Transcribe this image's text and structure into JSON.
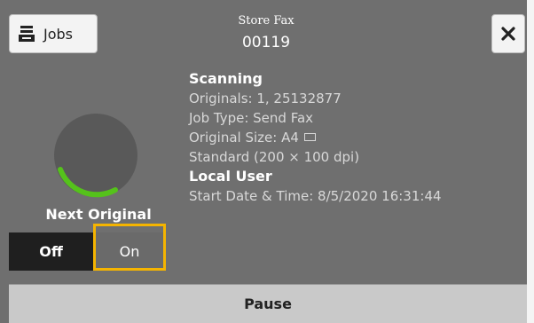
{
  "header": {
    "title": "Store Fax",
    "code": "00119",
    "jobs_label": "Jobs",
    "jobs_icon": "job-list-icon",
    "close_icon": "close-icon"
  },
  "progress": {
    "icon": "progress-spinner-icon",
    "accent_color": "#55c21b"
  },
  "details": {
    "heading_scanning": "Scanning",
    "originals": "Originals: 1, 25132877",
    "job_type": "Job Type: Send Fax",
    "original_size": "Original Size: A4",
    "original_size_icon": "paper-landscape-icon",
    "resolution": "Standard (200 × 100 dpi)",
    "heading_user": "Local User",
    "start": "Start Date & Time: 8/5/2020 16:31:44"
  },
  "next_original": {
    "label": "Next Original",
    "off_label": "Off",
    "on_label": "On",
    "highlight_color": "#f5b400"
  },
  "actions": {
    "pause_label": "Pause"
  }
}
